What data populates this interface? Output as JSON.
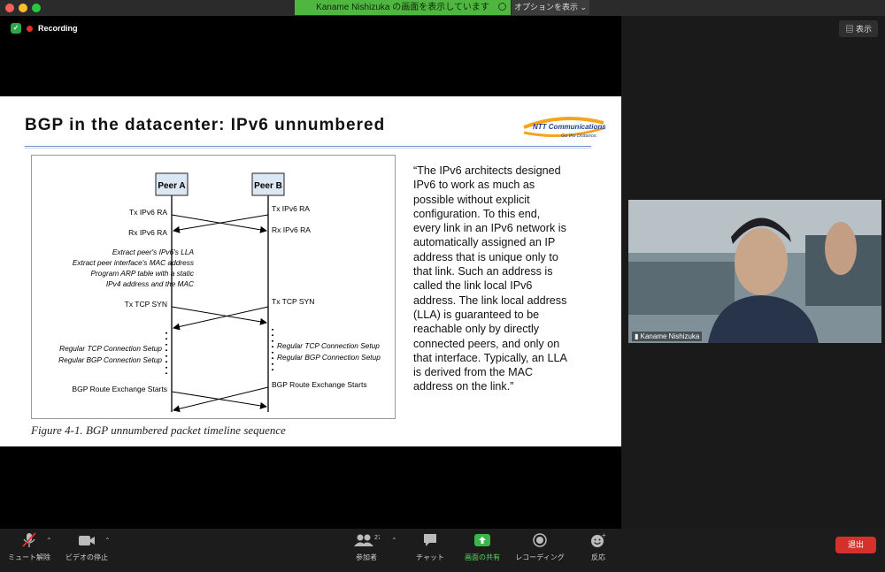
{
  "window": {
    "share_banner": "Kaname Nishizuka の画面を表示しています",
    "options_label": "オプションを表示"
  },
  "meeting": {
    "recording_label": "Recording",
    "view_label": "表示"
  },
  "slide": {
    "title": "BGP in the datacenter: IPv6 unnumbered",
    "logo": {
      "line1": "NTT Communications",
      "line2": "Go the Distance."
    },
    "diagram": {
      "peer_a": "Peer A",
      "peer_b": "Peer B",
      "left_labels": {
        "tx_ra": "Tx IPv6 RA",
        "rx_ra": "Rx IPv6 RA",
        "extract1": "Extract peer's IPv6's LLA",
        "extract2": "Extract peer interface's MAC address",
        "extract3": "Program ARP table with a static",
        "extract4": "IPv4 address and the MAC",
        "tx_syn": "Tx TCP SYN",
        "tcp_setup": "Regular TCP Connection Setup",
        "bgp_setup": "Regular BGP Connection Setup",
        "bgp_route": "BGP Route Exchange Starts"
      },
      "right_labels": {
        "tx_ra": "Tx IPv6 RA",
        "rx_ra": "Rx IPv6 RA",
        "tx_syn": "Tx TCP SYN",
        "tcp_setup": "Regular TCP Connection Setup",
        "bgp_setup": "Regular BGP Connection Setup",
        "bgp_route": "BGP Route Exchange Starts"
      }
    },
    "caption": "Figure 4-1. BGP unnumbered packet timeline sequence",
    "quote_lines": [
      "“The IPv6 architects designed",
      "IPv6 to work as much as",
      "possible without explicit",
      "configuration. To this end,",
      "every link in an IPv6 network is",
      "automatically assigned an IP",
      "address that is unique only to",
      "that link. Such an address is",
      "called the link local IPv6",
      "address. The link local address",
      "(LLA) is guaranteed to be",
      "reachable only by directly",
      "connected peers, and only on",
      "that interface. Typically, an LLA",
      "is derived from the MAC",
      "address on the link.”"
    ]
  },
  "participant": {
    "name": "Kaname Nishizuka"
  },
  "toolbar": {
    "unmute": "ミュート解除",
    "stop_video": "ビデオの停止",
    "participants": "参加者",
    "participants_count": "27",
    "chat": "チャット",
    "share_screen": "画面の共有",
    "recording": "レコーディング",
    "reactions": "反応",
    "leave": "退出"
  },
  "colors": {
    "accent_green": "#4fb640",
    "leave_red": "#d6302c",
    "recording_red": "#e0312a"
  }
}
